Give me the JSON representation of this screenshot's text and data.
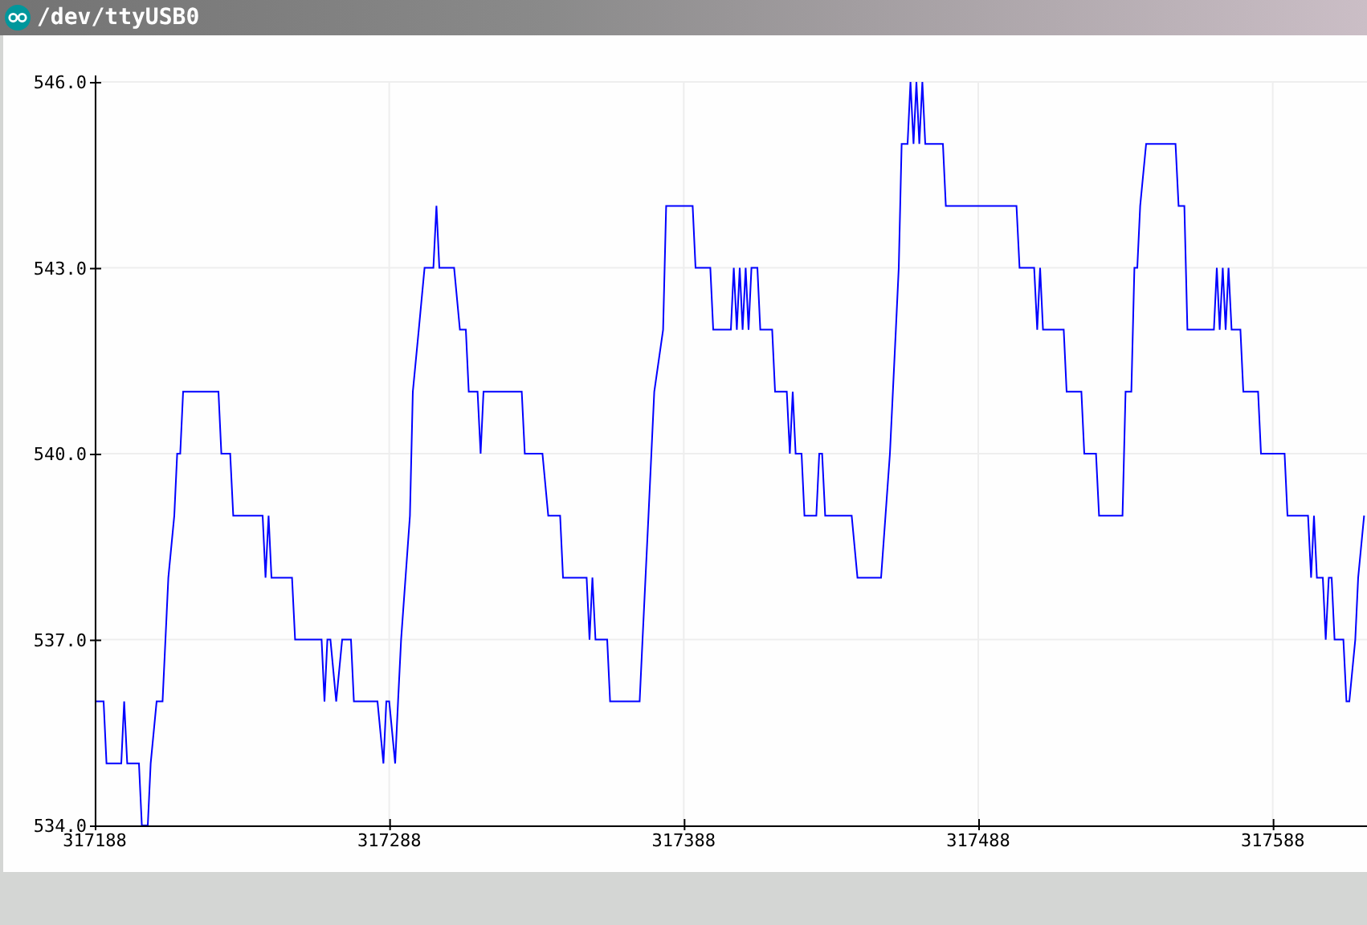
{
  "window": {
    "title": "/dev/ttyUSB0"
  },
  "plot": {
    "chart_data": {
      "type": "line",
      "x": [
        317188,
        317191,
        317192,
        317197,
        317198,
        317199,
        317203,
        317204,
        317206,
        317207,
        317209,
        317211,
        317213,
        317215,
        317216,
        317217,
        317218,
        317230,
        317231,
        317234,
        317235,
        317245,
        317246,
        317247,
        317248,
        317255,
        317256,
        317265,
        317266,
        317267,
        317268,
        317270,
        317272,
        317275,
        317276,
        317284,
        317286,
        317287,
        317288,
        317290,
        317291,
        317292,
        317295,
        317296,
        317298,
        317300,
        317303,
        317304,
        317305,
        317310,
        317312,
        317314,
        317315,
        317318,
        317319,
        317320,
        317333,
        317334,
        317340,
        317342,
        317346,
        317347,
        317355,
        317356,
        317357,
        317358,
        317362,
        317363,
        317373,
        317374,
        317376,
        317378,
        317381,
        317382,
        317391,
        317392,
        317397,
        317398,
        317404,
        317405,
        317406,
        317407,
        317408,
        317409,
        317410,
        317411,
        317413,
        317414,
        317418,
        317419,
        317423,
        317424,
        317425,
        317426,
        317428,
        317429,
        317433,
        317434,
        317435,
        317436,
        317445,
        317447,
        317455,
        317458,
        317460,
        317461,
        317462,
        317464,
        317465,
        317466,
        317467,
        317468,
        317469,
        317470,
        317476,
        317477,
        317501,
        317502,
        317507,
        317508,
        317509,
        317510,
        317517,
        317518,
        317523,
        317524,
        317528,
        317529,
        317537,
        317538,
        317540,
        317541,
        317542,
        317543,
        317545,
        317555,
        317556,
        317558,
        317559,
        317568,
        317569,
        317570,
        317571,
        317572,
        317573,
        317574,
        317577,
        317578,
        317583,
        317584,
        317592,
        317593,
        317600,
        317601,
        317602,
        317603,
        317605,
        317606,
        317607,
        317608,
        317609,
        317612,
        317613,
        317614,
        317616,
        317617,
        317619
      ],
      "grid": true,
      "series": [
        {
          "color": "#0000ff",
          "values": [
            536,
            536,
            535,
            535,
            536,
            535,
            535,
            534,
            534,
            535,
            536,
            536,
            538,
            539,
            540,
            540,
            541,
            541,
            540,
            540,
            539,
            539,
            538,
            539,
            538,
            538,
            537,
            537,
            536,
            537,
            537,
            536,
            537,
            537,
            536,
            536,
            535,
            536,
            536,
            535,
            536,
            537,
            539,
            541,
            542,
            543,
            543,
            544,
            543,
            543,
            542,
            542,
            541,
            541,
            540,
            541,
            541,
            540,
            540,
            539,
            539,
            538,
            538,
            537,
            538,
            537,
            537,
            536,
            536,
            537,
            539,
            541,
            542,
            544,
            544,
            543,
            543,
            542,
            542,
            543,
            542,
            543,
            542,
            543,
            542,
            543,
            543,
            542,
            542,
            541,
            541,
            540,
            541,
            540,
            540,
            539,
            539,
            540,
            540,
            539,
            539,
            538,
            538,
            540,
            542,
            543,
            545,
            545,
            546,
            545,
            546,
            545,
            546,
            545,
            545,
            544,
            544,
            543,
            543,
            542,
            543,
            542,
            542,
            541,
            541,
            540,
            540,
            539,
            539,
            541,
            541,
            543,
            543,
            544,
            545,
            545,
            544,
            544,
            542,
            542,
            543,
            542,
            543,
            542,
            543,
            542,
            542,
            541,
            541,
            540,
            540,
            539,
            539,
            538,
            539,
            538,
            538,
            537,
            538,
            538,
            537,
            537,
            536,
            536,
            537,
            538,
            539
          ]
        }
      ],
      "xlim": [
        317188,
        317620
      ],
      "ylim": [
        534,
        546
      ],
      "xticks": [
        317188,
        317288,
        317388,
        317488,
        317588
      ],
      "yticks": [
        {
          "value": 534,
          "label": "534.0"
        },
        {
          "value": 537,
          "label": "537.0"
        },
        {
          "value": 540,
          "label": "540.0"
        },
        {
          "value": 543,
          "label": "543.0"
        },
        {
          "value": 546,
          "label": "546.0"
        }
      ]
    }
  }
}
